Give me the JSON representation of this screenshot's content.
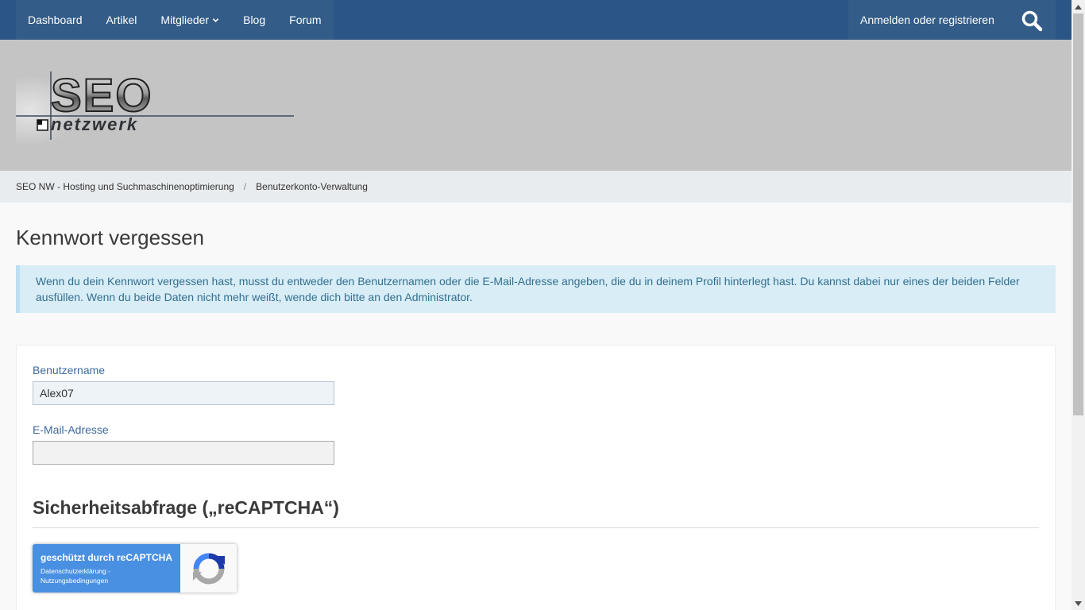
{
  "nav": {
    "items": [
      {
        "label": "Dashboard"
      },
      {
        "label": "Artikel"
      },
      {
        "label": "Mitglieder"
      },
      {
        "label": "Blog"
      },
      {
        "label": "Forum"
      }
    ],
    "login": "Anmelden oder registrieren",
    "search_icon": "search-icon"
  },
  "header": {
    "logo_top": "SEO",
    "logo_bottom": "netzwerk"
  },
  "breadcrumb": {
    "items": [
      {
        "label": "SEO NW - Hosting und Suchmaschinenoptimierung"
      },
      {
        "label": "Benutzerkonto-Verwaltung"
      }
    ],
    "separator": "/"
  },
  "main": {
    "title": "Kennwort vergessen",
    "info": "Wenn du dein Kennwort vergessen hast, musst du entweder den Benutzernamen oder die E-Mail-Adresse angeben, die du in deinem Profil hinterlegt hast. Du kannst dabei nur eines der beiden Felder ausfüllen. Wenn du beide Daten nicht mehr weißt, wende dich bitte an den Administrator."
  },
  "form": {
    "username_label": "Benutzername",
    "username_value": "Alex07",
    "email_label": "E-Mail-Adresse",
    "email_value": "",
    "captcha_title": "Sicherheitsabfrage („reCAPTCHA“)",
    "recaptcha": {
      "main": "geschützt durch reCAPTCHA",
      "privacy": "Datenschutzerklärung",
      "sep": " - ",
      "terms": "Nutzungsbedingungen"
    }
  },
  "colors": {
    "nav_bg": "#2b5584",
    "nav_item_bg": "#335c88",
    "header_bg": "#c4c4c4",
    "info_bg": "#d9edf7",
    "label_color": "#3d6a9c",
    "recaptcha_blue": "#4a90e2"
  }
}
